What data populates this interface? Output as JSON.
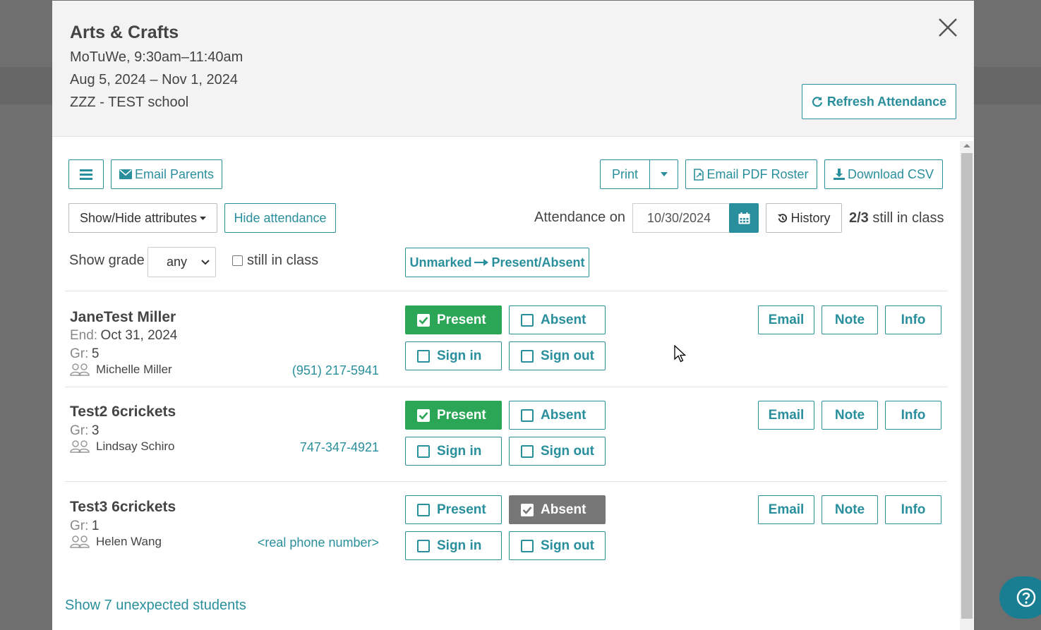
{
  "header": {
    "title": "Arts & Crafts",
    "schedule": "MoTuWe, 9:30am–11:40am",
    "dates": "Aug 5, 2024 – Nov 1, 2024",
    "school": "ZZZ - TEST school",
    "refresh_label": "Refresh Attendance"
  },
  "toolbar": {
    "email_parents": "Email Parents",
    "print": "Print",
    "email_pdf": "Email PDF Roster",
    "download_csv": "Download CSV",
    "show_hide": "Show/Hide attributes",
    "hide_attendance": "Hide attendance",
    "attendance_on": "Attendance on",
    "attendance_date": "10/30/2024",
    "history": "History",
    "count_bold": "2/3",
    "count_rest": "still in class",
    "show_grade": "Show grade",
    "grade_value": "any",
    "still_in_class": "still in class",
    "unmarked_left": "Unmarked",
    "unmarked_right": "Present/Absent"
  },
  "labels": {
    "present": "Present",
    "absent": "Absent",
    "sign_in": "Sign in",
    "sign_out": "Sign out",
    "email": "Email",
    "note": "Note",
    "info": "Info",
    "end": "End:",
    "gr": "Gr:"
  },
  "students": [
    {
      "name": "JaneTest Miller",
      "end": "Oct 31, 2024",
      "grade": "5",
      "parent": "Michelle Miller",
      "phone": "(951) 217-5941",
      "present": true,
      "absent": false
    },
    {
      "name": "Test2 6crickets",
      "grade": "3",
      "parent": "Lindsay Schiro",
      "phone": "747-347-4921",
      "present": true,
      "absent": false
    },
    {
      "name": "Test3 6crickets",
      "grade": "1",
      "parent": "Helen Wang",
      "phone": "<real phone number>",
      "present": false,
      "absent": true
    }
  ],
  "footer": {
    "unexpected": "Show 7 unexpected students"
  },
  "colors": {
    "accent": "#2a8f9c",
    "present": "#2aa656",
    "absent": "#777777"
  }
}
